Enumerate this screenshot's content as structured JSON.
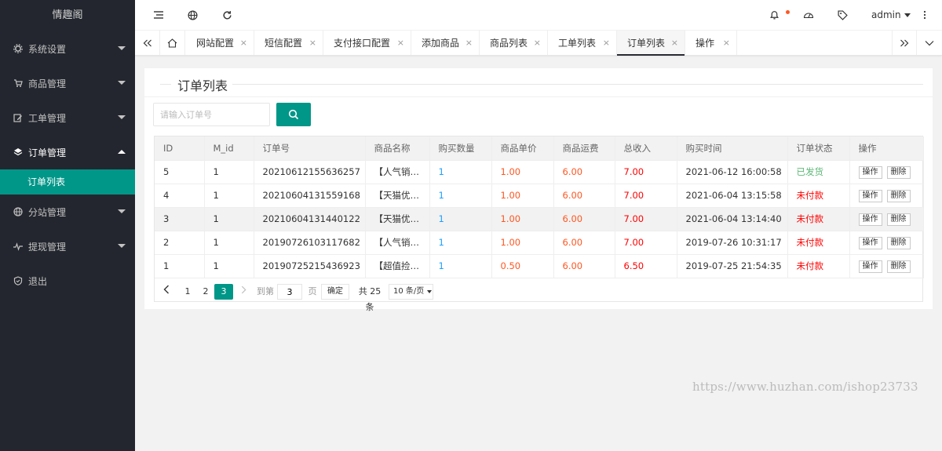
{
  "app": {
    "title": "情趣阁"
  },
  "sidebar": {
    "items": [
      {
        "label": "系统设置",
        "icon": "gear-icon"
      },
      {
        "label": "商品管理",
        "icon": "cart-icon"
      },
      {
        "label": "工单管理",
        "icon": "edit-icon"
      },
      {
        "label": "订单管理",
        "icon": "layers-icon"
      },
      {
        "label": "分站管理",
        "icon": "globe-icon"
      },
      {
        "label": "提现管理",
        "icon": "pulse-icon"
      },
      {
        "label": "退出",
        "icon": "shield-icon"
      }
    ],
    "sub_item": "订单列表"
  },
  "header": {
    "user": "admin"
  },
  "tabs": [
    {
      "label": "网站配置"
    },
    {
      "label": "短信配置"
    },
    {
      "label": "支付接口配置"
    },
    {
      "label": "添加商品"
    },
    {
      "label": "商品列表"
    },
    {
      "label": "工单列表"
    },
    {
      "label": "订单列表"
    },
    {
      "label": "操作"
    }
  ],
  "tab_close": "×",
  "card": {
    "title": "订单列表",
    "search_placeholder": "请输入订单号"
  },
  "table": {
    "headers": [
      "ID",
      "M_id",
      "订单号",
      "商品名称",
      "购买数量",
      "商品单价",
      "商品运费",
      "总收入",
      "购买时间",
      "订单状态",
      "操作"
    ],
    "rows": [
      {
        "id": "5",
        "mid": "1",
        "order_no": "20210612155636257",
        "name": "【人气销…",
        "qty": "1",
        "price": "1.00",
        "freight": "6.00",
        "income": "7.00",
        "time": "2021-06-12 16:00:58",
        "status": "已发货"
      },
      {
        "id": "4",
        "mid": "1",
        "order_no": "20210604131559168",
        "name": "【天猫优…",
        "qty": "1",
        "price": "1.00",
        "freight": "6.00",
        "income": "7.00",
        "time": "2021-06-04 13:15:58",
        "status": "未付款"
      },
      {
        "id": "3",
        "mid": "1",
        "order_no": "20210604131440122",
        "name": "【天猫优…",
        "qty": "1",
        "price": "1.00",
        "freight": "6.00",
        "income": "7.00",
        "time": "2021-06-04 13:14:40",
        "status": "未付款"
      },
      {
        "id": "2",
        "mid": "1",
        "order_no": "20190726103117682",
        "name": "【人气销…",
        "qty": "1",
        "price": "1.00",
        "freight": "6.00",
        "income": "7.00",
        "time": "2019-07-26 10:31:17",
        "status": "未付款"
      },
      {
        "id": "1",
        "mid": "1",
        "order_no": "20190725215436923",
        "name": "【超值捡…",
        "qty": "1",
        "price": "0.50",
        "freight": "6.00",
        "income": "6.50",
        "time": "2019-07-25 21:54:35",
        "status": "未付款"
      }
    ],
    "op_btn": "操作",
    "del_btn": "删除"
  },
  "pager": {
    "pages": [
      "1",
      "2",
      "3"
    ],
    "current": "3",
    "goto_label": "到第",
    "goto_value": "3",
    "page_unit": "页",
    "ok": "确定",
    "total": "共 25 条",
    "per_page": "10 条/页"
  },
  "watermark": "https://www.huzhan.com/ishop23733",
  "colors": {
    "accent": "#009688",
    "sidebar": "#23262e",
    "blue": "#1e9fff",
    "orange": "#ff5722",
    "red": "#ff0000",
    "green": "#5fb878"
  }
}
